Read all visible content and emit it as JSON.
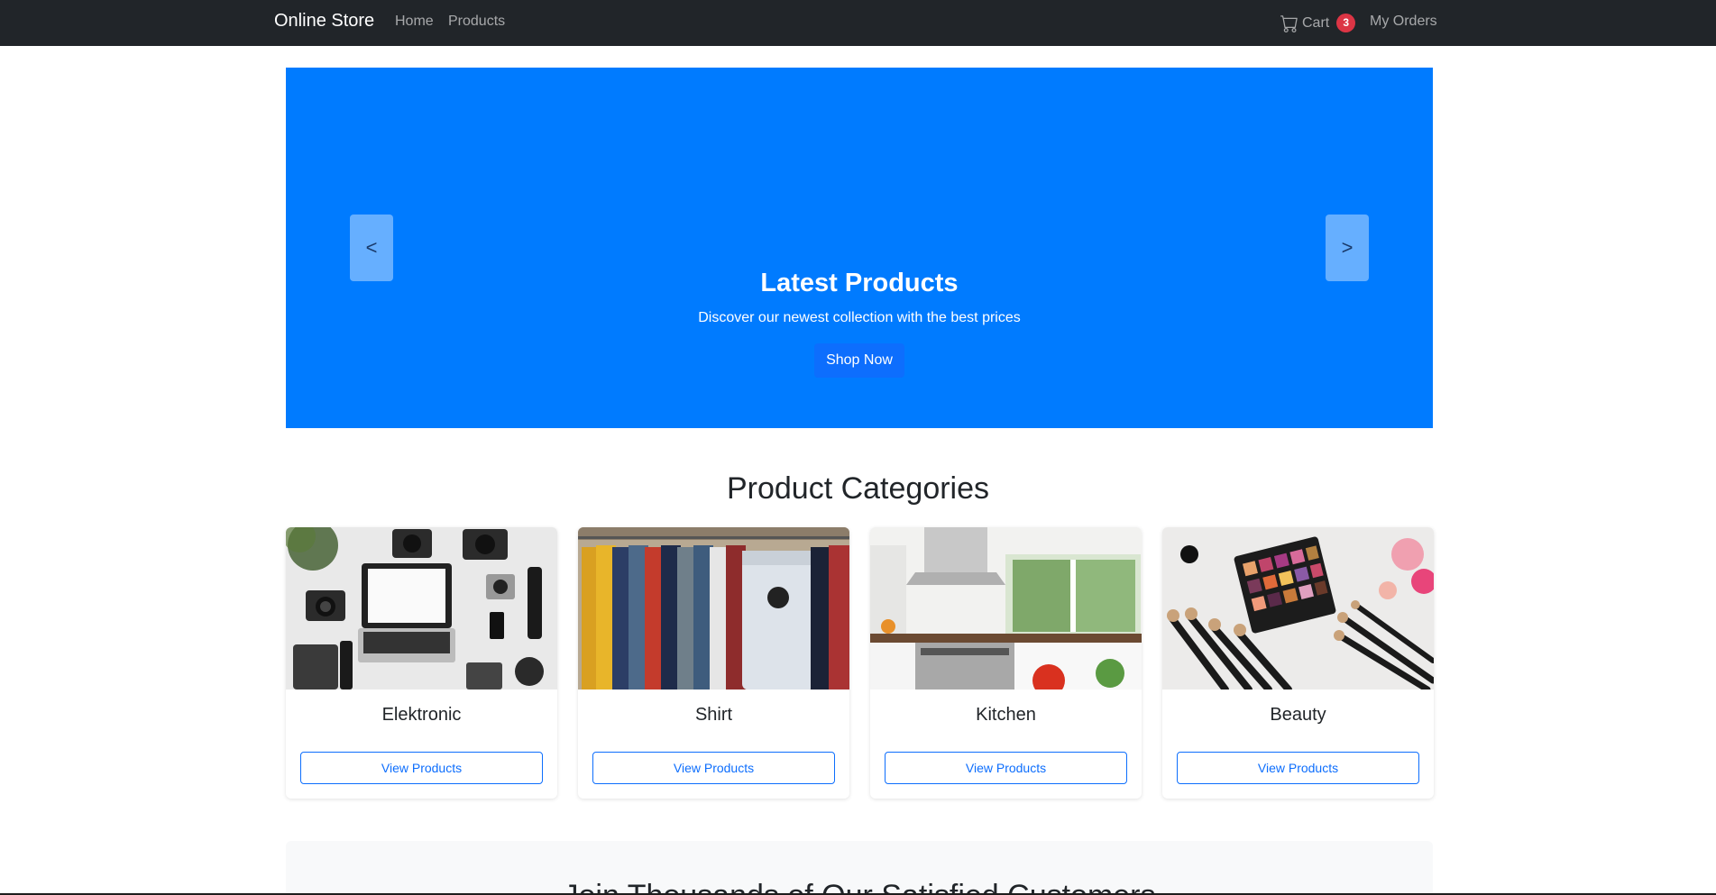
{
  "navbar": {
    "brand": "Online Store",
    "links": {
      "home": "Home",
      "products": "Products",
      "cart": "Cart",
      "orders": "My Orders"
    },
    "cart_count": "3",
    "cart_icon": "cart-icon"
  },
  "hero": {
    "title": "Latest Products",
    "subtitle": "Discover our newest collection with the best prices",
    "button": "Shop Now",
    "prev": "<",
    "next": ">",
    "background_color": "#007bff"
  },
  "categories": {
    "title": "Product Categories",
    "items": [
      {
        "name": "Elektronic",
        "button": "View Products",
        "image": "electronics-flatlay"
      },
      {
        "name": "Shirt",
        "button": "View Products",
        "image": "shirts-on-rack"
      },
      {
        "name": "Kitchen",
        "button": "View Products",
        "image": "modern-kitchen"
      },
      {
        "name": "Beauty",
        "button": "View Products",
        "image": "makeup-palette-brushes"
      }
    ]
  },
  "testimonials": {
    "title": "Join Thousands of Our Satisfied Customers"
  },
  "colors": {
    "navbar": "#212529",
    "primary": "#0d6efd",
    "badge": "#dc3545"
  }
}
